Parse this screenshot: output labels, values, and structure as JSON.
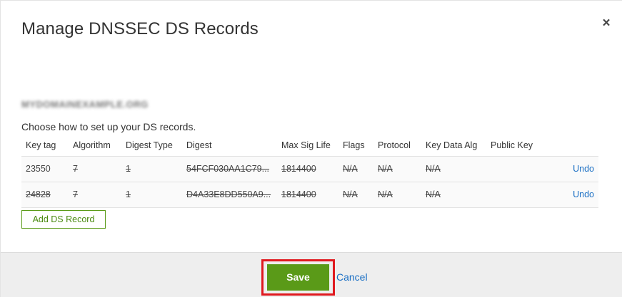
{
  "dialog": {
    "title": "Manage DNSSEC DS Records",
    "domain": "MYDOMAINEXAMPLE.ORG",
    "instructions": "Choose how to set up your DS records."
  },
  "table": {
    "headers": [
      "Key tag",
      "Algorithm",
      "Digest Type",
      "Digest",
      "Max Sig Life",
      "Flags",
      "Protocol",
      "Key Data Alg",
      "Public Key"
    ],
    "rows": [
      {
        "key_tag": "23550",
        "algorithm": "7",
        "digest_type": "1",
        "digest": "54FCF030AA1C79...",
        "max_sig_life": "1814400",
        "flags": "N/A",
        "protocol": "N/A",
        "key_data_alg": "N/A",
        "public_key": "",
        "action": "Undo"
      },
      {
        "key_tag": "24828",
        "algorithm": "7",
        "digest_type": "1",
        "digest": "D4A33E8DD550A9...",
        "max_sig_life": "1814400",
        "flags": "N/A",
        "protocol": "N/A",
        "key_data_alg": "N/A",
        "public_key": "",
        "action": "Undo"
      }
    ]
  },
  "buttons": {
    "add_ds_record": "Add DS Record",
    "save": "Save",
    "cancel": "Cancel",
    "close": "×"
  },
  "colors": {
    "accent_green": "#5a9a18",
    "link_blue": "#1a6fc4",
    "highlight_red": "#e0191f"
  }
}
